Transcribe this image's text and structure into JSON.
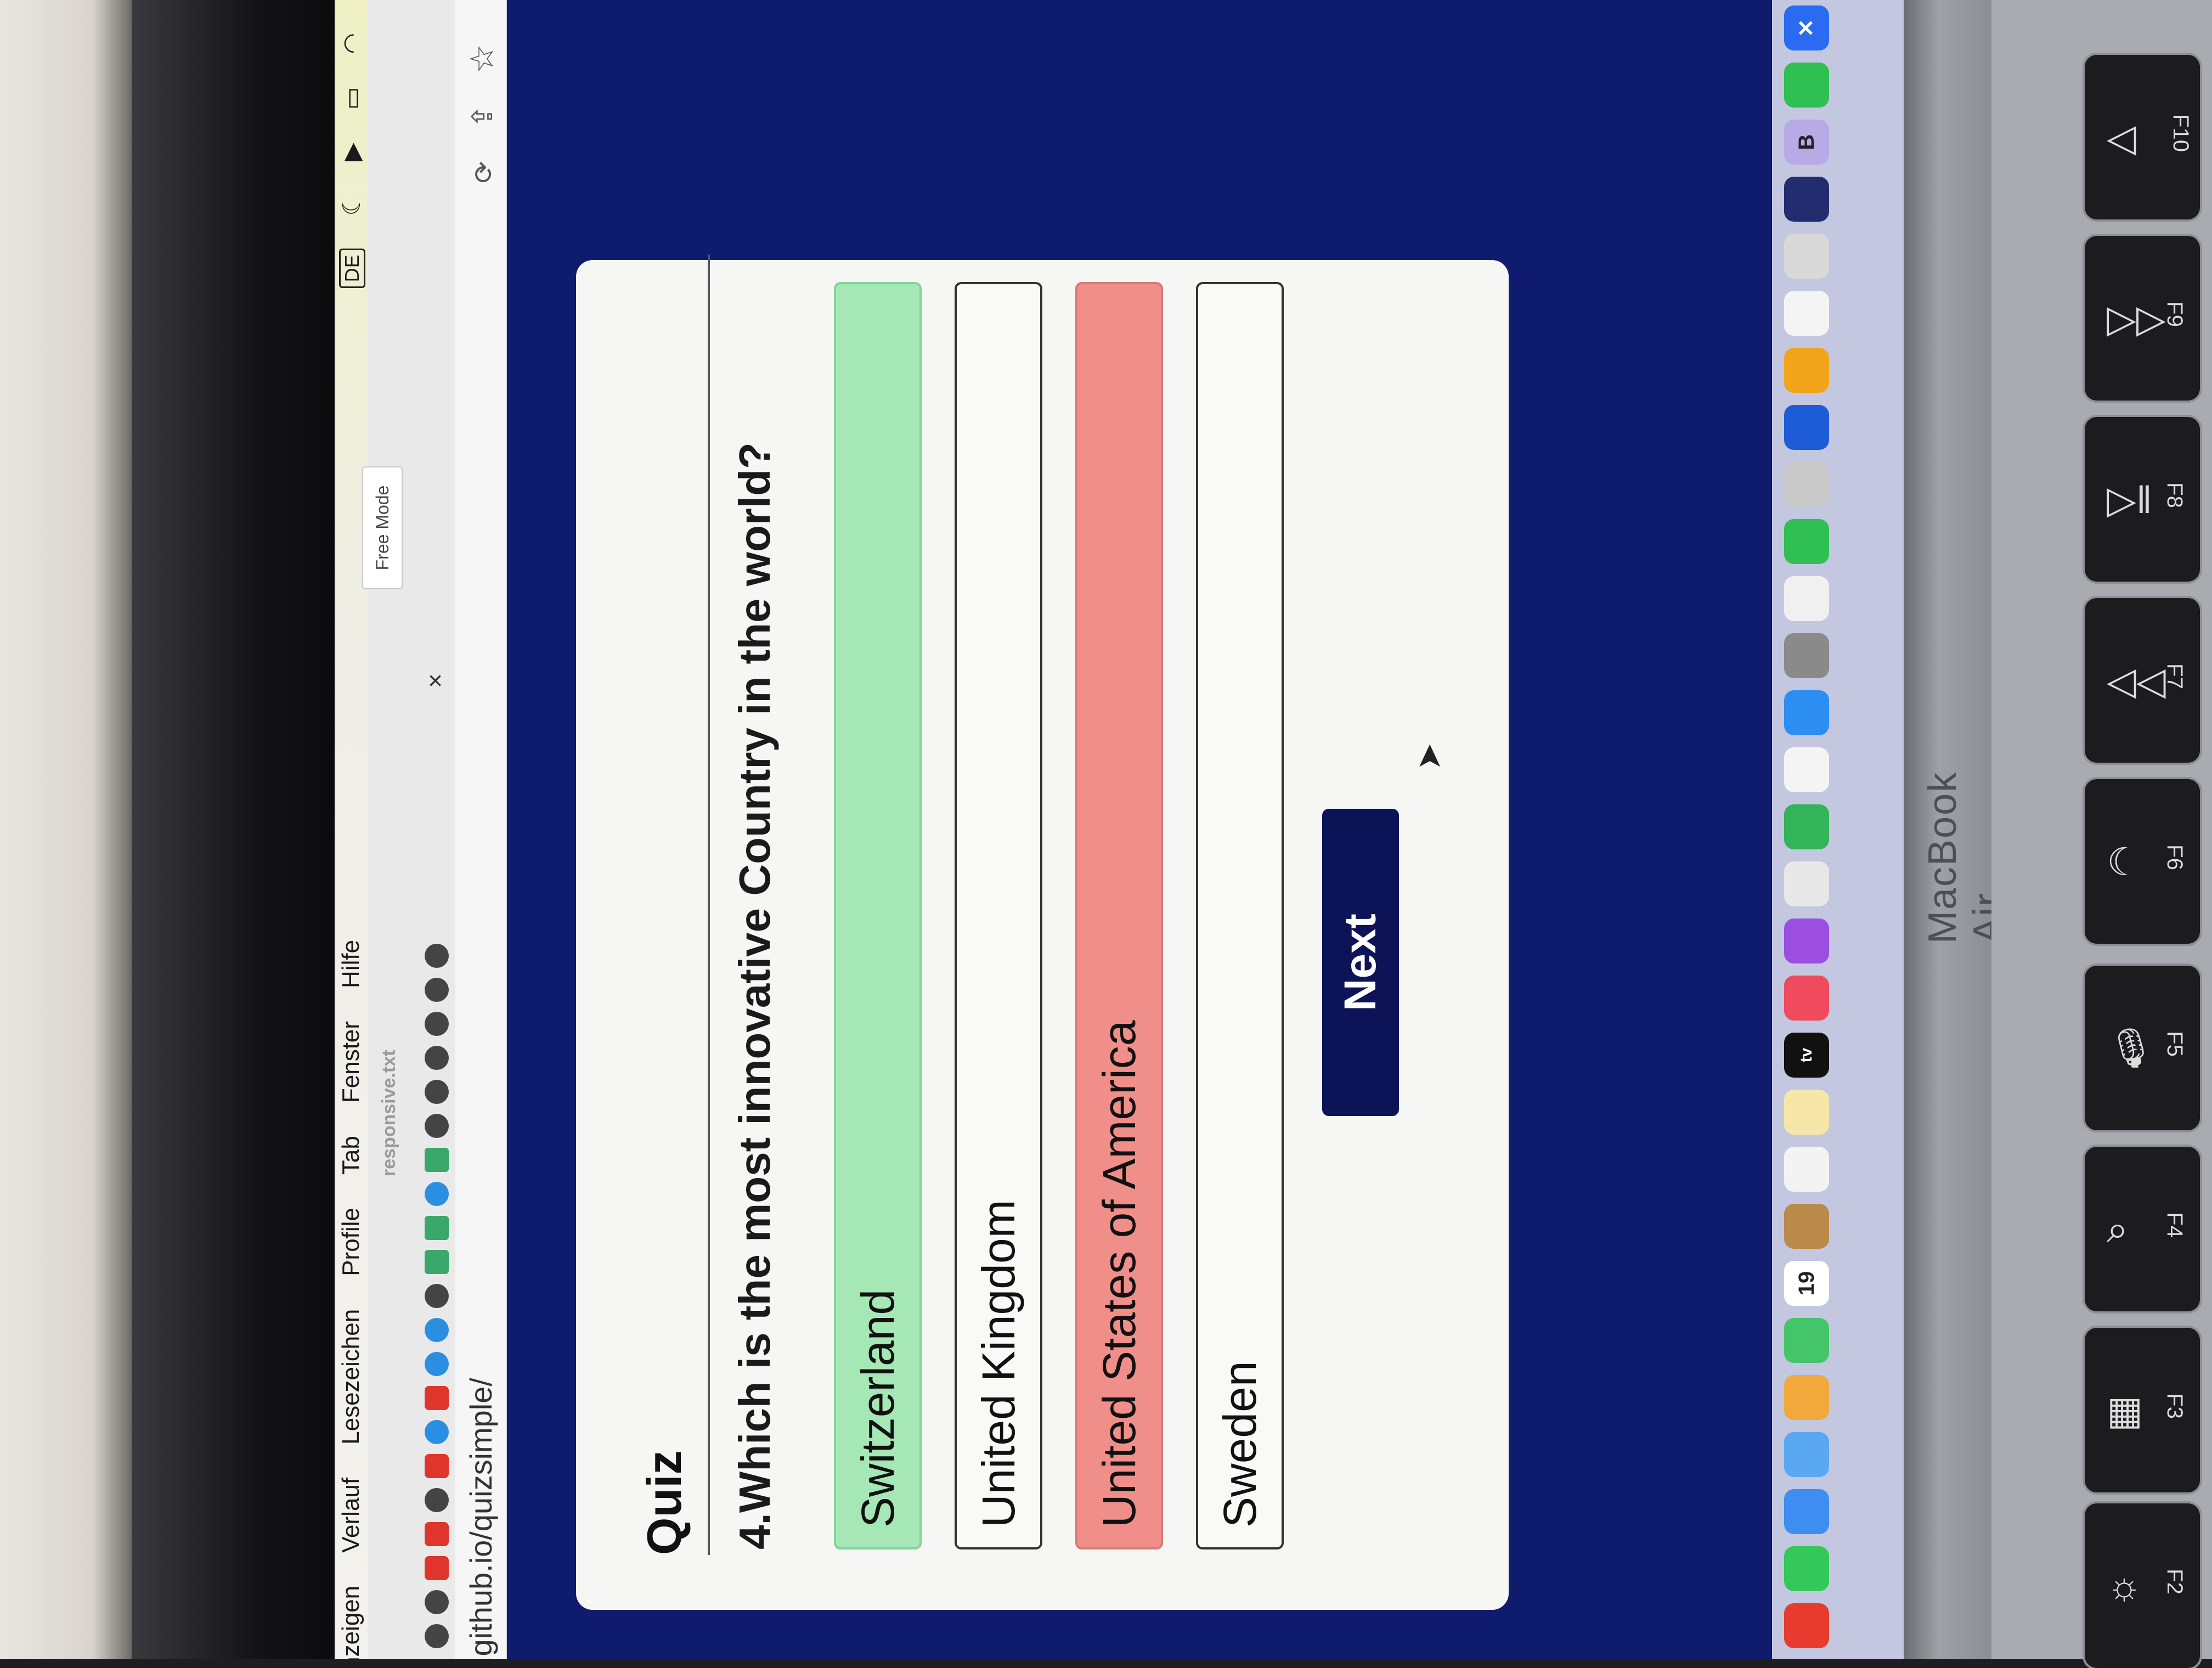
{
  "menubar": {
    "items": [
      "nzeigen",
      "Verlauf",
      "Lesezeichen",
      "Profile",
      "Tab",
      "Fenster",
      "Hilfe"
    ],
    "language_badge": "DE"
  },
  "tabs": {
    "active_tab_label": "Free Mode",
    "tab_title": "responsive.txt",
    "close_symbol": "×"
  },
  "address_bar": {
    "url": ".github.io/quizsimple/"
  },
  "quiz": {
    "title": "Quiz",
    "question": "4.Which is the most innovative Country in the world?",
    "options": [
      {
        "label": "Switzerland",
        "state": "correct",
        "color": "#a6e7b6"
      },
      {
        "label": "United Kingdom",
        "state": "neutral",
        "color": "#f9f9f7"
      },
      {
        "label": "United States of America",
        "state": "wrong",
        "color": "#f08f8a"
      },
      {
        "label": "Sweden",
        "state": "neutral",
        "color": "#f9f9f7"
      }
    ],
    "next_label": "Next"
  },
  "dock": {
    "calendar_day": "19",
    "tv_label": "tv"
  },
  "hardware": {
    "model_label": "MacBook Air",
    "function_keys": [
      "F2",
      "F3",
      "F4",
      "F5",
      "F6",
      "F7",
      "F8",
      "F9",
      "F10"
    ]
  },
  "colors": {
    "desktop": "#0f1c6e",
    "next_button": "#0c1357"
  }
}
